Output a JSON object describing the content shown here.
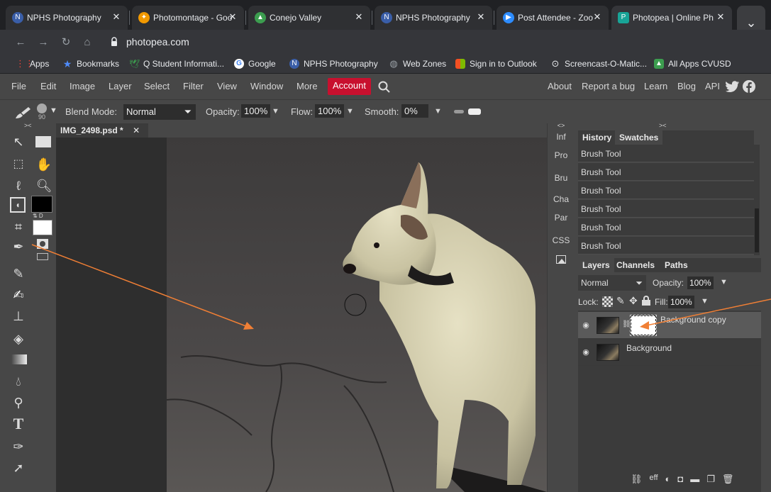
{
  "browser": {
    "tabs": [
      {
        "title": "NPHS Photography",
        "icon": "npps-logo-icon",
        "color": "#3a5ea8"
      },
      {
        "title": "Photomontage - Goo",
        "icon": "pinwheel-icon",
        "color": "#f29900"
      },
      {
        "title": "Conejo Valley",
        "icon": "school-icon",
        "color": "#3c9d4f"
      },
      {
        "title": "NPHS Photography",
        "icon": "npps-logo-icon",
        "color": "#3a5ea8"
      },
      {
        "title": "Post Attendee - Zoo",
        "icon": "zoom-icon",
        "color": "#2d8cff"
      },
      {
        "title": "Photopea | Online Ph",
        "icon": "photopea-icon",
        "color": "#18a497"
      }
    ],
    "url": "photopea.com",
    "bookmarks": [
      {
        "label": "Apps",
        "icon": "apps-grid-icon",
        "color": "#e94235"
      },
      {
        "label": "Bookmarks",
        "icon": "star-icon",
        "color": "#4f8bf9"
      },
      {
        "label": "Q Student Informati...",
        "icon": "bird-icon",
        "color": "#3c9d4f"
      },
      {
        "label": "Google",
        "icon": "google-icon",
        "color": "#4285f4"
      },
      {
        "label": "NPHS Photography",
        "icon": "npps-logo-icon",
        "color": "#3a5ea8"
      },
      {
        "label": "Web Zones",
        "icon": "globe-icon",
        "color": "#9aa0a6"
      },
      {
        "label": "Sign in to Outlook",
        "icon": "microsoft-icon",
        "color": "#f25022"
      },
      {
        "label": "Screencast-O-Matic...",
        "icon": "screencast-icon",
        "color": "#4f8bf9"
      },
      {
        "label": "All Apps CVUSD",
        "icon": "school-icon",
        "color": "#3c9d4f"
      }
    ]
  },
  "app": {
    "menu": [
      "File",
      "Edit",
      "Image",
      "Layer",
      "Select",
      "Filter",
      "View",
      "Window",
      "More"
    ],
    "account_label": "Account",
    "right_menu": [
      "About",
      "Report a bug",
      "Learn",
      "Blog",
      "API"
    ],
    "options": {
      "brush_size": "90",
      "blend_label": "Blend Mode:",
      "blend_value": "Normal",
      "opacity_label": "Opacity:",
      "opacity_value": "100%",
      "flow_label": "Flow:",
      "flow_value": "100%",
      "smooth_label": "Smooth:",
      "smooth_value": "0%"
    },
    "document_tab": "IMG_2498.psd *",
    "side_strip": [
      "Inf",
      "Pro",
      "Bru",
      "Cha",
      "Par",
      "CSS"
    ],
    "history_tabs": [
      "History",
      "Swatches"
    ],
    "history": [
      "Brush Tool",
      "Brush Tool",
      "Brush Tool",
      "Brush Tool",
      "Brush Tool",
      "Brush Tool"
    ],
    "layers_tabs": [
      "Layers",
      "Channels",
      "Paths"
    ],
    "layers_blend": "Normal",
    "layers_opacity_label": "Opacity:",
    "layers_opacity": "100%",
    "lock_label": "Lock:",
    "fill_label": "Fill:",
    "fill_value": "100%",
    "layers": [
      {
        "name": "Background copy"
      },
      {
        "name": "Background"
      }
    ],
    "layer_footer_fx": "eff",
    "panel_collapse": "><",
    "strip_collapse": "<>"
  },
  "colors": {
    "account_red": "#c8102e",
    "annotation_orange": "#f07f35"
  }
}
